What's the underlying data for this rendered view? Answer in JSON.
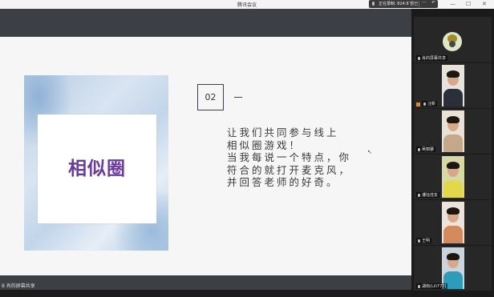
{
  "titlebar": {
    "title": "腾讯会议"
  },
  "recording": {
    "text": "正在录制: 824:8 暂已",
    "more": "···",
    "back": "↶"
  },
  "window_controls": {
    "minimize": "—",
    "maximize": "☐",
    "close": "✕"
  },
  "slide": {
    "card_title": "相似圈",
    "number": "02",
    "lines": [
      "让我们共同参与线上",
      "相似圈游戏！",
      "当我每说一个特点，你",
      "符合的就打开麦克风，",
      "并回答老师的好奇。"
    ]
  },
  "share_label": "8 肖的屏幕共享",
  "participants": [
    {
      "label": "肖的屏幕共享"
    },
    {
      "label": "汪新"
    },
    {
      "label": "吴丽娜"
    },
    {
      "label": "潘钰佳友"
    },
    {
      "label": "王明"
    },
    {
      "label": "湖南(Lili777)"
    }
  ]
}
